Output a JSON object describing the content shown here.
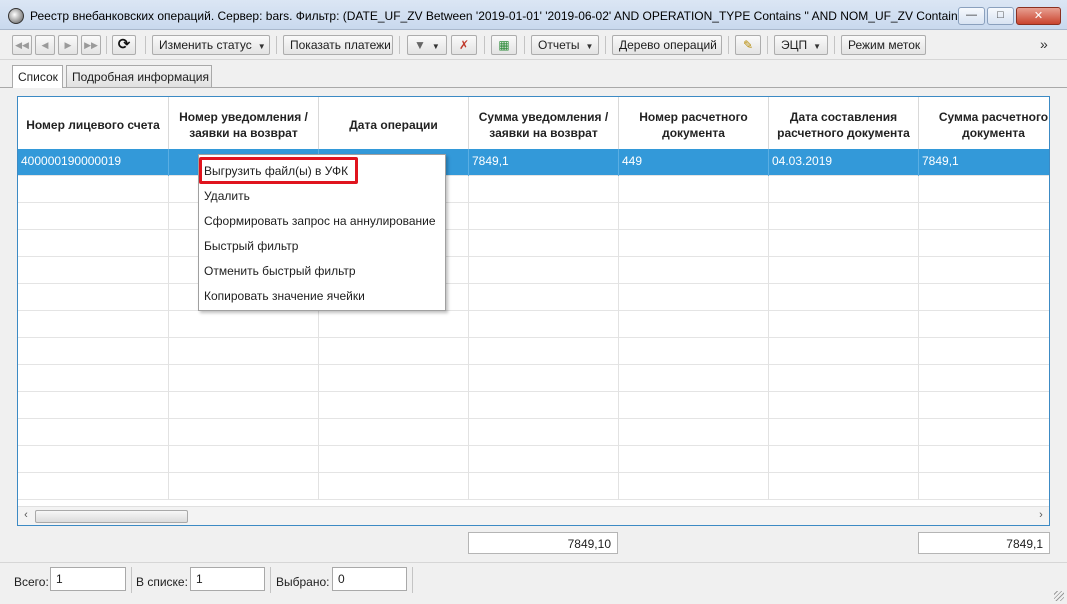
{
  "window": {
    "title": "Реестр внебанковских операций. Сервер: bars. Фильтр: (DATE_UF_ZV Between '2019-01-01' '2019-06-02' AND OPERATION_TYPE Contains '' AND NOM_UF_ZV Contains '' A...",
    "minimize_glyph": "—",
    "maximize_glyph": "□",
    "close_glyph": "✕"
  },
  "toolbar": {
    "nav_first": "◀◀",
    "nav_prev": "◀",
    "nav_next": "▶",
    "nav_last": "▶▶",
    "refresh_glyph": "⟳",
    "change_status": "Изменить статус",
    "show_payments": "Показать платежи",
    "filter_glyph": "▼",
    "clear_filter_glyph": "✗",
    "export_glyph": "▦",
    "reports": "Отчеты",
    "operations_tree": "Дерево операций",
    "sign_glyph": "✎",
    "ecp": "ЭЦП",
    "marks_mode": "Режим меток",
    "overflow": "»",
    "dropdown_arrow": "▼"
  },
  "tabs": [
    {
      "label": "Список",
      "active": true
    },
    {
      "label": "Подробная информация",
      "active": false
    }
  ],
  "table": {
    "columns": [
      "Номер лицевого счета",
      "Номер уведомления / заявки на возврат",
      "Дата операции",
      "Сумма уведомления / заявки на возврат",
      "Номер расчетного документа",
      "Дата составления расчетного документа",
      "Сумма расчетного документа"
    ],
    "rows": [
      [
        "400000190000019",
        "",
        "",
        "7849,1",
        "449",
        "04.03.2019",
        "7849,1"
      ]
    ],
    "empty_rows": 12,
    "scroll_left": "‹",
    "scroll_right": "›"
  },
  "totals": {
    "notice_sum": "7849,10",
    "doc_sum": "7849,1"
  },
  "status": {
    "total_label": "Всего:",
    "total_value": "1",
    "in_list_label": "В списке:",
    "in_list_value": "1",
    "selected_label": "Выбрано:",
    "selected_value": "0"
  },
  "context_menu": {
    "items": [
      "Выгрузить файл(ы) в УФК",
      "Удалить",
      "Сформировать запрос на аннулирование",
      "Быстрый фильтр",
      "Отменить быстрый фильтр",
      "Копировать значение ячейки"
    ],
    "highlight_color": "#e0141e"
  },
  "colors": {
    "selection": "#3399d9",
    "panel_border": "#3c8ac4"
  }
}
